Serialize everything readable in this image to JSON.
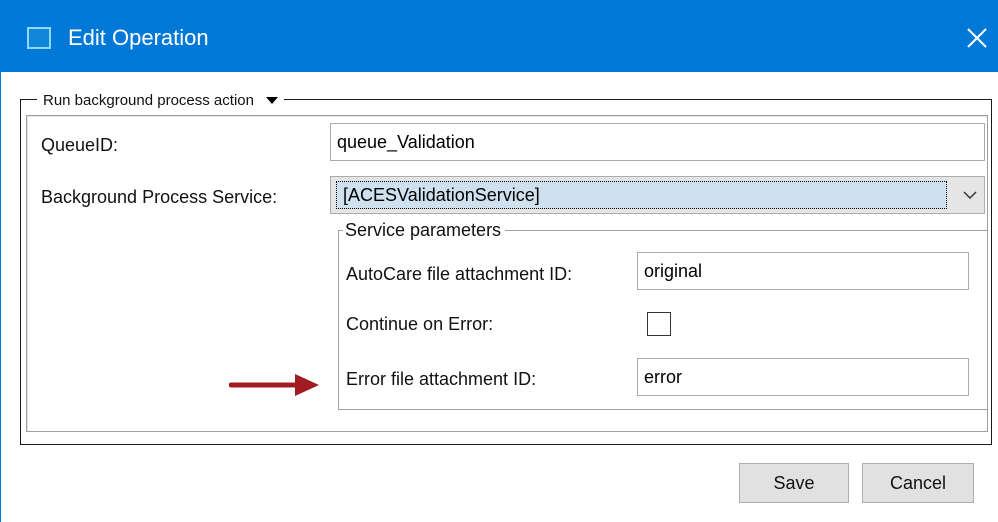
{
  "window": {
    "title": "Edit Operation",
    "accent_color": "#0078d7",
    "app_icon": "window-icon",
    "close_icon": "close-icon"
  },
  "action_group": {
    "legend": "Run background process action",
    "legend_icon": "caret-down-icon"
  },
  "form": {
    "queue_id_label": "QueueID:",
    "queue_id_value": "queue_Validation",
    "service_label": "Background Process Service:",
    "service_value": "[ACESValidationService]",
    "service_icon": "chevron-down-icon"
  },
  "service_parameters": {
    "legend": "Service parameters",
    "attachment_label": "AutoCare file attachment ID:",
    "attachment_value": "original",
    "continue_label": "Continue on Error:",
    "continue_checked": false,
    "error_label": "Error file attachment ID:",
    "error_value": "error"
  },
  "annotation": {
    "arrow_color": "#a01c22",
    "arrow_icon": "arrow-right-icon"
  },
  "buttons": {
    "save_label": "Save",
    "cancel_label": "Cancel"
  }
}
